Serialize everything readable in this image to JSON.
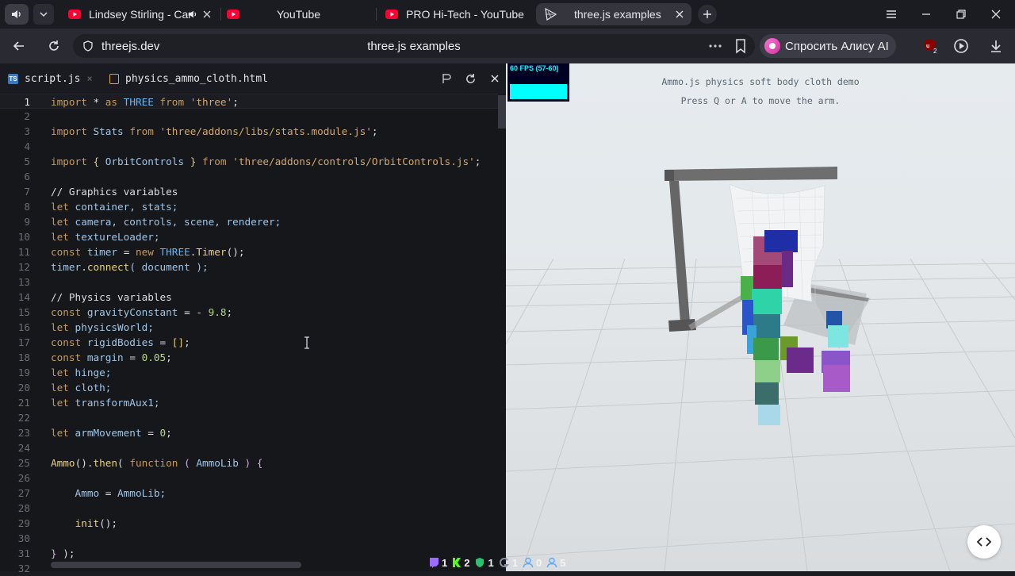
{
  "browser": {
    "tabs": [
      {
        "title": "Lindsey Stirling - Car",
        "active": false
      },
      {
        "title": "YouTube",
        "active": false
      },
      {
        "title": "PRO Hi-Tech - YouTube",
        "active": false
      },
      {
        "title": "three.js examples",
        "active": true
      }
    ],
    "address": {
      "domain": "threejs.dev",
      "page_title": "three.js examples"
    },
    "alice_label": "Спросить Алису AI",
    "extension_badge": "2",
    "colors": {
      "youtube": "#ff0033",
      "alice": "#d63a9c"
    }
  },
  "editor": {
    "tabs": [
      {
        "label": "script.js",
        "icon": "typescript-icon",
        "active": true
      },
      {
        "label": "physics_ammo_cloth.html",
        "icon": "html-file-icon",
        "active": false
      }
    ],
    "lines": [
      {
        "n": "1"
      },
      {
        "n": "2"
      },
      {
        "n": "3"
      },
      {
        "n": "4"
      },
      {
        "n": "5"
      },
      {
        "n": "6"
      },
      {
        "n": "7"
      },
      {
        "n": "8"
      },
      {
        "n": "9"
      },
      {
        "n": "10"
      },
      {
        "n": "11"
      },
      {
        "n": "12"
      },
      {
        "n": "13"
      },
      {
        "n": "14"
      },
      {
        "n": "15"
      },
      {
        "n": "16"
      },
      {
        "n": "17"
      },
      {
        "n": "18"
      },
      {
        "n": "19"
      },
      {
        "n": "20"
      },
      {
        "n": "21"
      },
      {
        "n": "22"
      },
      {
        "n": "23"
      },
      {
        "n": "24"
      },
      {
        "n": "25"
      },
      {
        "n": "26"
      },
      {
        "n": "27"
      },
      {
        "n": "28"
      },
      {
        "n": "29"
      },
      {
        "n": "30"
      },
      {
        "n": "31"
      },
      {
        "n": "32"
      }
    ],
    "code": {
      "l1_a": "import",
      "l1_b": " * ",
      "l1_c": "as",
      "l1_d": " THREE ",
      "l1_e": "from",
      "l1_f": " ",
      "l1_g": "'three'",
      "l1_h": ";",
      "l3_a": "import",
      "l3_b": " Stats ",
      "l3_c": "from",
      "l3_d": " ",
      "l3_e": "'three/addons/libs/stats.module.js'",
      "l3_f": ";",
      "l5_a": "import",
      "l5_b": " { ",
      "l5_c": "OrbitControls",
      "l5_d": " } ",
      "l5_e": "from",
      "l5_f": " ",
      "l5_g": "'three/addons/controls/OrbitControls.js'",
      "l5_h": ";",
      "l7": "// Graphics variables",
      "l8_a": "let",
      "l8_b": " container, stats;",
      "l9_a": "let",
      "l9_b": " camera, controls, scene, renderer;",
      "l10_a": "let",
      "l10_b": " textureLoader;",
      "l11_a": "const",
      "l11_b": " timer ",
      "l11_c": "=",
      "l11_d": " ",
      "l11_e": "new",
      "l11_f": " ",
      "l11_g": "THREE",
      "l11_h": ".",
      "l11_i": "Timer",
      "l11_j": "();",
      "l12_a": "timer",
      "l12_b": ".",
      "l12_c": "connect",
      "l12_d": "( document );",
      "l14": "// Physics variables",
      "l15_a": "const",
      "l15_b": " gravityConstant ",
      "l15_c": "=",
      "l15_d": " - ",
      "l15_e": "9.8",
      "l15_f": ";",
      "l16_a": "let",
      "l16_b": " physicsWorld;",
      "l17_a": "const",
      "l17_b": " rigidBodies ",
      "l17_c": "=",
      "l17_d": " ",
      "l17_e": "[]",
      "l17_f": ";",
      "l18_a": "const",
      "l18_b": " margin ",
      "l18_c": "=",
      "l18_d": " ",
      "l18_e": "0.05",
      "l18_f": ";",
      "l19_a": "let",
      "l19_b": " hinge;",
      "l20_a": "let",
      "l20_b": " cloth;",
      "l21_a": "let",
      "l21_b": " transformAux1;",
      "l23_a": "let",
      "l23_b": " armMovement ",
      "l23_c": "=",
      "l23_d": " ",
      "l23_e": "0",
      "l23_f": ";",
      "l25_a": "Ammo",
      "l25_b": "().",
      "l25_c": "then",
      "l25_d": "( ",
      "l25_e": "function",
      "l25_f": " ( ",
      "l25_g": "AmmoLib",
      "l25_h": " ) ",
      "l25_i": "{",
      "l27_a": "    Ammo ",
      "l27_b": "=",
      "l27_c": " AmmoLib;",
      "l29_a": "    ",
      "l29_b": "init",
      "l29_c": "();",
      "l31_a": "}",
      "l31_b": " );"
    }
  },
  "viewport": {
    "fps_text": "60 FPS (57-60)",
    "info_line1": "Ammo.js physics soft body cloth demo",
    "info_line2": "Press Q or A to move the arm."
  },
  "status_counters": [
    {
      "icon": "twitch-icon",
      "value": "1",
      "color": "#9b6cff"
    },
    {
      "icon": "kick-icon",
      "value": "2",
      "color": "#53fc18"
    },
    {
      "icon": "shield-icon",
      "value": "1",
      "color": "#2fbf71"
    },
    {
      "icon": "g-icon",
      "value": "1",
      "color": "#8a8fa0"
    },
    {
      "icon": "user-icon",
      "value": "0",
      "color": "#5aa9ff"
    },
    {
      "icon": "users-icon",
      "value": "5",
      "color": "#5aa9ff"
    }
  ]
}
